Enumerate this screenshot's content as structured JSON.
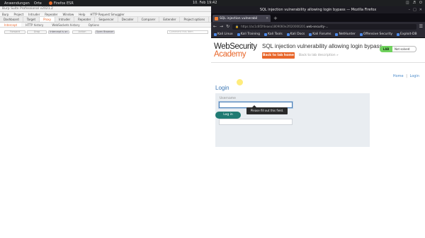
{
  "desktop": {
    "menu1": "Anwendungen",
    "menu2": "Orte",
    "app": "Firefox ESR",
    "clock": "10. Feb  19:42"
  },
  "burp": {
    "title": "Burp Suite Professional v2021.2",
    "menu": [
      "Burp",
      "Project",
      "Intruder",
      "Repeater",
      "Window",
      "Help",
      "HTTP Request Smuggler"
    ],
    "tabs": [
      "Dashboard",
      "Target",
      "Proxy",
      "Intruder",
      "Repeater",
      "Sequencer",
      "Decoder",
      "Comparer",
      "Extender",
      "Project options",
      "User options"
    ],
    "subtabs": [
      "Intercept",
      "HTTP history",
      "WebSockets history",
      "Options"
    ],
    "buttons": {
      "forward": "Forward",
      "drop": "Drop",
      "intercept": "Intercept is on",
      "action": "Action",
      "open_browser": "Open Browser"
    },
    "comment_placeholder": "Comment this item"
  },
  "firefox": {
    "window_title": "SQL injection vulnerability allowing login bypass — Mozilla Firefox",
    "tab_title": "SQL injection vulnerabil",
    "url_prefix": "https://ac1c6f2f4eaea1809060e2f020000201",
    "url_domain": ".web-security-...",
    "bookmarks": [
      "Kali Linux",
      "Kali Training",
      "Kali Tools",
      "Kali Docs",
      "Kali Forums",
      "NetHunter",
      "Offensive Security",
      "Exploit-DB"
    ]
  },
  "page": {
    "logo_line1": "WebSecurity",
    "logo_line2": "Academy",
    "lab_title": "SQL injection vulnerability allowing login bypass",
    "back_button": "Back to lab home",
    "back_desc": "Back to lab description »",
    "lab_badge": "LAB",
    "status": "Not solved",
    "nav_home": "Home",
    "nav_sep": "|",
    "nav_login": "Login",
    "heading": "Login",
    "username_label": "Username",
    "password_label": "Password",
    "tooltip": "Please fill out this field.",
    "login_button": "Log in"
  },
  "colors": {
    "accent": "#e8662a",
    "link": "#3a76b3",
    "button_teal": "#1f7a73",
    "lab_green": "#70d25e"
  }
}
